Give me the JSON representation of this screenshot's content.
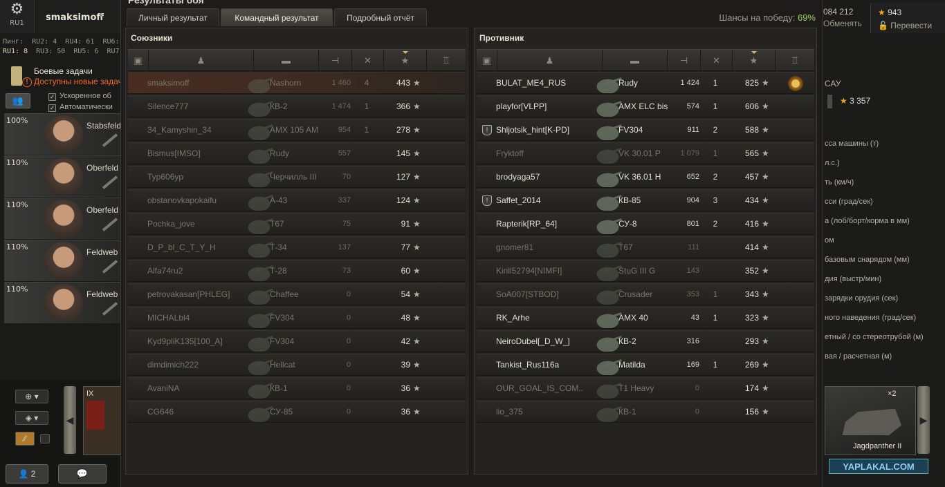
{
  "hangar": {
    "server": "RU1",
    "player_name": "smaksimoff",
    "ping_label": "Пинг:",
    "ping": [
      [
        "RU2: 4",
        "RU4: 61",
        "RU6: 4"
      ],
      [
        "RU1: 8",
        "RU3: 50",
        "RU5: 6",
        "RU7: 4"
      ]
    ],
    "missions_title": "Боевые задачи",
    "missions_new": "Доступны новые задачи",
    "checkbox_accelerated": "Ускоренное об",
    "checkbox_auto": "Автоматически",
    "crew": [
      {
        "pct": "100%",
        "rank": "Stabsfeld"
      },
      {
        "pct": "110%",
        "rank": "Oberfeld"
      },
      {
        "pct": "110%",
        "rank": "Oberfeld"
      },
      {
        "pct": "110%",
        "rank": "Feldweb"
      },
      {
        "pct": "110%",
        "rank": "Feldweb"
      }
    ],
    "left_tier": "IX",
    "platoon_count": "2",
    "credits": "084 212",
    "exchange_label": "Обменять",
    "gold": "943",
    "convert_label": "Перевести",
    "vehicle_short": "САУ",
    "exp_value": "3 357",
    "stats_lines": [
      "сса машины (т)",
      "л.с.)",
      "ть (км/ч)",
      "сси (град/сек)",
      "а (лоб/борт/корма в мм)",
      "ом",
      "базовым снарядом (мм)",
      "дия (выстр/мин)",
      "зарядки орудия (сек)",
      "ного наведения (град/сек)",
      "етный / со стереотрубой (м)",
      "вая / расчетная (м)"
    ],
    "right_tank_name": "Jagdpanther II",
    "right_tank_mult": "×2",
    "watermark": "YAPLAKAL.COM"
  },
  "window": {
    "title": "Результаты боя",
    "tabs": [
      "Личный результат",
      "Командный результат",
      "Подробный отчёт"
    ],
    "active_tab": 1,
    "win_chance_label": "Шансы на победу:",
    "win_chance_value": "69%"
  },
  "allies": {
    "title": "Союзники",
    "rows": [
      {
        "name": "smaksimoff",
        "tank": "Nashorn",
        "damage": "1 460",
        "kills": "4",
        "xp": "443",
        "dead": true,
        "me": true,
        "badge": false,
        "medal": false
      },
      {
        "name": "Silence777",
        "tank": "КВ-2",
        "damage": "1 474",
        "kills": "1",
        "xp": "366",
        "dead": true,
        "me": false,
        "badge": false,
        "medal": false
      },
      {
        "name": "34_Kamyshin_34",
        "tank": "AMX 105 AM",
        "damage": "954",
        "kills": "1",
        "xp": "278",
        "dead": true,
        "me": false,
        "badge": false,
        "medal": false
      },
      {
        "name": "Bismus[IMSO]",
        "tank": "Rudy",
        "damage": "557",
        "kills": "",
        "xp": "145",
        "dead": true,
        "me": false,
        "badge": false,
        "medal": false
      },
      {
        "name": "Typ606yp",
        "tank": "Черчилль III",
        "damage": "70",
        "kills": "",
        "xp": "127",
        "dead": true,
        "me": false,
        "badge": false,
        "medal": false
      },
      {
        "name": "obstanovkapokaifu",
        "tank": "А-43",
        "damage": "337",
        "kills": "",
        "xp": "124",
        "dead": true,
        "me": false,
        "badge": false,
        "medal": false
      },
      {
        "name": "Pochka_jove",
        "tank": "T67",
        "damage": "75",
        "kills": "",
        "xp": "91",
        "dead": true,
        "me": false,
        "badge": false,
        "medal": false
      },
      {
        "name": "D_P_bl_C_T_Y_H",
        "tank": "Т-34",
        "damage": "137",
        "kills": "",
        "xp": "77",
        "dead": true,
        "me": false,
        "badge": false,
        "medal": false
      },
      {
        "name": "Alfa74ru2",
        "tank": "Т-28",
        "damage": "73",
        "kills": "",
        "xp": "60",
        "dead": true,
        "me": false,
        "badge": false,
        "medal": false
      },
      {
        "name": "petrovakasan[PHLEG]",
        "tank": "Chaffee",
        "damage": "0",
        "kills": "",
        "xp": "54",
        "dead": true,
        "me": false,
        "badge": false,
        "medal": false
      },
      {
        "name": "MICHALbl4",
        "tank": "FV304",
        "damage": "0",
        "kills": "",
        "xp": "48",
        "dead": true,
        "me": false,
        "badge": false,
        "medal": false
      },
      {
        "name": "Kyd9pliK135[100_A]",
        "tank": "FV304",
        "damage": "0",
        "kills": "",
        "xp": "42",
        "dead": true,
        "me": false,
        "badge": false,
        "medal": false
      },
      {
        "name": "dimdimich222",
        "tank": "Hellcat",
        "damage": "0",
        "kills": "",
        "xp": "39",
        "dead": true,
        "me": false,
        "badge": false,
        "medal": false
      },
      {
        "name": "AvaniNA",
        "tank": "КВ-1",
        "damage": "0",
        "kills": "",
        "xp": "36",
        "dead": true,
        "me": false,
        "badge": false,
        "medal": false
      },
      {
        "name": "CG646",
        "tank": "СУ-85",
        "damage": "0",
        "kills": "",
        "xp": "36",
        "dead": true,
        "me": false,
        "badge": false,
        "medal": false
      }
    ]
  },
  "enemies": {
    "title": "Противник",
    "rows": [
      {
        "name": "BULAT_ME4_RUS",
        "tank": "Rudy",
        "damage": "1 424",
        "kills": "1",
        "xp": "825",
        "dead": false,
        "me": false,
        "badge": false,
        "medal": true
      },
      {
        "name": "playfor[VLPP]",
        "tank": "AMX ELC bis",
        "damage": "574",
        "kills": "1",
        "xp": "606",
        "dead": false,
        "me": false,
        "badge": false,
        "medal": false
      },
      {
        "name": "Shljotsik_hint[K-PD]",
        "tank": "FV304",
        "damage": "911",
        "kills": "2",
        "xp": "588",
        "dead": false,
        "me": false,
        "badge": true,
        "medal": false
      },
      {
        "name": "Fryktoff",
        "tank": "VK 30.01 P",
        "damage": "1 079",
        "kills": "1",
        "xp": "565",
        "dead": true,
        "me": false,
        "badge": false,
        "medal": false
      },
      {
        "name": "brodyaga57",
        "tank": "VK 36.01 H",
        "damage": "652",
        "kills": "2",
        "xp": "457",
        "dead": false,
        "me": false,
        "badge": false,
        "medal": false
      },
      {
        "name": "Saffet_2014",
        "tank": "КВ-85",
        "damage": "904",
        "kills": "3",
        "xp": "434",
        "dead": false,
        "me": false,
        "badge": true,
        "medal": false
      },
      {
        "name": "Rapterik[RP_64]",
        "tank": "СУ-8",
        "damage": "801",
        "kills": "2",
        "xp": "416",
        "dead": false,
        "me": false,
        "badge": false,
        "medal": false
      },
      {
        "name": "gnomer81",
        "tank": "T67",
        "damage": "111",
        "kills": "",
        "xp": "414",
        "dead": true,
        "me": false,
        "badge": false,
        "medal": false
      },
      {
        "name": "Kirill52794[NIMFI]",
        "tank": "StuG III G",
        "damage": "143",
        "kills": "",
        "xp": "352",
        "dead": true,
        "me": false,
        "badge": false,
        "medal": false
      },
      {
        "name": "SoA007[STBOD]",
        "tank": "Crusader",
        "damage": "353",
        "kills": "1",
        "xp": "343",
        "dead": true,
        "me": false,
        "badge": false,
        "medal": false
      },
      {
        "name": "RK_Arhe",
        "tank": "AMX 40",
        "damage": "43",
        "kills": "1",
        "xp": "323",
        "dead": false,
        "me": false,
        "badge": false,
        "medal": false
      },
      {
        "name": "NeiroDubel[_D_W_]",
        "tank": "КВ-2",
        "damage": "316",
        "kills": "",
        "xp": "293",
        "dead": false,
        "me": false,
        "badge": false,
        "medal": false
      },
      {
        "name": "Tankist_Rus116a",
        "tank": "Matilda",
        "damage": "169",
        "kills": "1",
        "xp": "269",
        "dead": false,
        "me": false,
        "badge": false,
        "medal": false
      },
      {
        "name": "OUR_GOAL_IS_COM..",
        "tank": "T1 Heavy",
        "damage": "0",
        "kills": "",
        "xp": "174",
        "dead": true,
        "me": false,
        "badge": false,
        "medal": false
      },
      {
        "name": "lio_375",
        "tank": "КВ-1",
        "damage": "0",
        "kills": "",
        "xp": "156",
        "dead": true,
        "me": false,
        "badge": false,
        "medal": false
      }
    ]
  },
  "icons": {
    "star": "★",
    "gear": "⚙",
    "badge": "!"
  }
}
